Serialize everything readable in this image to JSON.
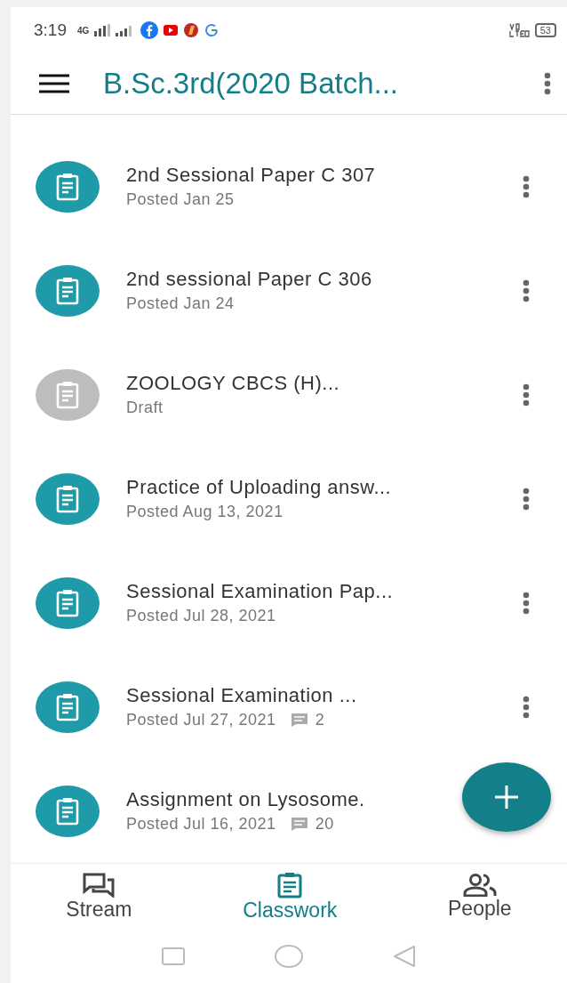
{
  "status_bar": {
    "time": "3:19",
    "network": "4G",
    "battery": "53"
  },
  "app_bar": {
    "title": "B.Sc.3rd(2020 Batch..."
  },
  "assignments": [
    {
      "title": "2nd Sessional Paper C 307",
      "status": "Posted Jan 25",
      "draft": false
    },
    {
      "title": "2nd sessional Paper C 306",
      "status": "Posted Jan 24",
      "draft": false
    },
    {
      "title": "ZOOLOGY CBCS (H)...",
      "status": "Draft",
      "draft": true
    },
    {
      "title": "Practice of Uploading answ...",
      "status": "Posted Aug 13, 2021",
      "draft": false
    },
    {
      "title": "Sessional Examination Pap...",
      "status": "Posted Jul 28, 2021",
      "draft": false
    },
    {
      "title": "Sessional Examination ...",
      "status": "Posted Jul 27, 2021",
      "draft": false,
      "comments": "2"
    },
    {
      "title": "Assignment on Lysosome.",
      "status": "Posted Jul 16, 2021",
      "draft": false,
      "comments": "20"
    }
  ],
  "bottom_nav": [
    {
      "label": "Stream",
      "kind": "stream",
      "selected": false
    },
    {
      "label": "Classwork",
      "kind": "classwork",
      "selected": true
    },
    {
      "label": "People",
      "kind": "people",
      "selected": false
    }
  ]
}
